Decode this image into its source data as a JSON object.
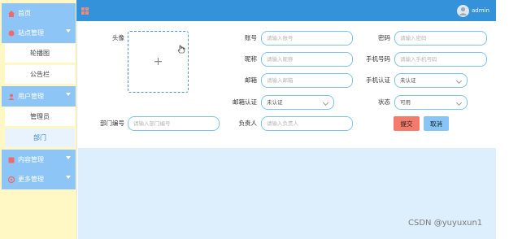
{
  "sidebar": {
    "items": [
      {
        "label": "首页"
      },
      {
        "label": "站点管理",
        "children": [
          "轮播图",
          "公告栏"
        ]
      },
      {
        "label": "用户管理",
        "children": [
          "管理员",
          "部门"
        ]
      },
      {
        "label": "内容管理"
      },
      {
        "label": "更多管理"
      }
    ]
  },
  "topbar": {
    "user": "admin"
  },
  "form": {
    "avatar_label": "头像",
    "account": {
      "label": "账号",
      "placeholder": "请输入账号"
    },
    "password": {
      "label": "密码",
      "placeholder": "请输入密码"
    },
    "nickname": {
      "label": "昵称",
      "placeholder": "请输入昵称"
    },
    "phone": {
      "label": "手机号码",
      "placeholder": "请输入手机号码"
    },
    "email": {
      "label": "邮箱",
      "placeholder": "请输入邮箱"
    },
    "phone_verify": {
      "label": "手机认证",
      "value": "未认证"
    },
    "email_verify": {
      "label": "邮箱认证",
      "value": "未认证"
    },
    "status": {
      "label": "状态",
      "value": "可用"
    },
    "dept_no": {
      "label": "部门编号",
      "placeholder": "请输入部门编号"
    },
    "owner": {
      "label": "负责人",
      "placeholder": "请输入负责人"
    },
    "submit": "提交",
    "cancel": "取消"
  },
  "watermark": "CSDN @yuyuxun1",
  "colors": {
    "topbar": "#3392d9",
    "menu": "#8ec5f7",
    "sidebar_bg": "#fff8c4",
    "submit": "#f47a6c",
    "cancel": "#87c4f7"
  }
}
